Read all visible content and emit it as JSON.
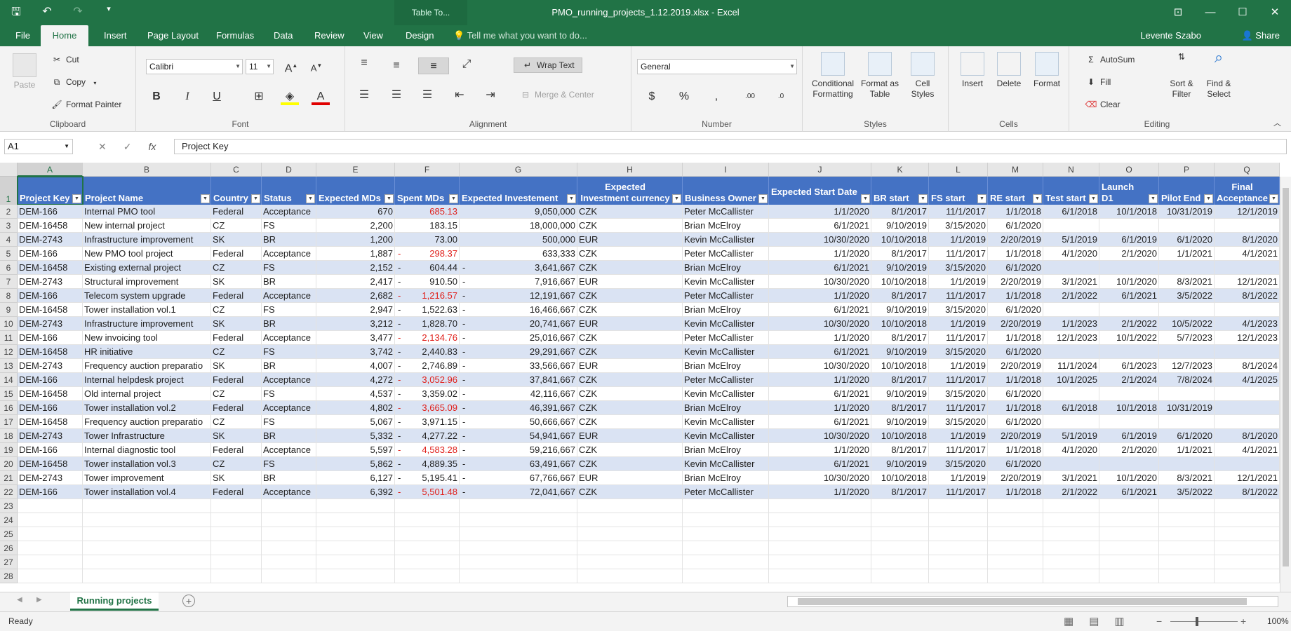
{
  "window": {
    "title": "PMO_running_projects_1.12.2019.xlsx - Excel",
    "context_tab": "Table To..."
  },
  "menu": {
    "tabs": [
      "File",
      "Home",
      "Insert",
      "Page Layout",
      "Formulas",
      "Data",
      "Review",
      "View",
      "Design"
    ],
    "tell_me": "Tell me what you want to do...",
    "user": "Levente Szabo",
    "share": "Share"
  },
  "ribbon": {
    "clipboard": {
      "label": "Clipboard",
      "paste": "Paste",
      "cut": "Cut",
      "copy": "Copy",
      "format_painter": "Format Painter"
    },
    "font": {
      "label": "Font",
      "name": "Calibri",
      "size": "11"
    },
    "alignment": {
      "label": "Alignment",
      "wrap": "Wrap Text",
      "merge": "Merge & Center"
    },
    "number": {
      "label": "Number",
      "format": "General"
    },
    "styles": {
      "label": "Styles",
      "conditional": "Conditional Formatting",
      "format_table": "Format as Table",
      "cell_styles": "Cell Styles"
    },
    "cells": {
      "label": "Cells",
      "insert": "Insert",
      "delete": "Delete",
      "format": "Format"
    },
    "editing": {
      "label": "Editing",
      "autosum": "AutoSum",
      "fill": "Fill",
      "clear": "Clear",
      "sort": "Sort & Filter",
      "find": "Find & Select"
    }
  },
  "formula_bar": {
    "name_box": "A1",
    "formula": "Project Key",
    "fx": "fx"
  },
  "columns": [
    "A",
    "B",
    "C",
    "D",
    "E",
    "F",
    "G",
    "H",
    "I",
    "J",
    "K",
    "L",
    "M",
    "N",
    "O",
    "P",
    "Q"
  ],
  "headers": [
    "Project Key",
    "Project Name",
    "Country",
    "Status",
    "Expected MDs",
    "Spent MDs",
    "Expected Investement",
    "Expected Investment currency",
    "Business Owner",
    "Expected Start Date",
    "BR start",
    "FS start",
    "RE start",
    "Test start",
    "Launch D1",
    "Pilot End",
    "Final Acceptance"
  ],
  "rows": [
    [
      "DEM-166",
      "Internal PMO tool",
      "Federal",
      "Acceptance",
      "670",
      "685.13",
      "",
      "9,050,000",
      "",
      "CZK",
      "Peter McCallister",
      "1/1/2020",
      "8/1/2017",
      "11/1/2017",
      "1/1/2018",
      "6/1/2018",
      "10/1/2018",
      "10/31/2019",
      "12/1/2019"
    ],
    [
      "DEM-16458",
      "New internal project",
      "CZ",
      "FS",
      "2,200",
      "183.15",
      "",
      "18,000,000",
      "",
      "CZK",
      "Brian McElroy",
      "6/1/2021",
      "9/10/2019",
      "3/15/2020",
      "6/1/2020",
      "",
      "",
      "",
      ""
    ],
    [
      "DEM-2743",
      "Infrastructure improvement",
      "SK",
      "BR",
      "1,200",
      "73.00",
      "",
      "500,000",
      "",
      "EUR",
      "Kevin McCallister",
      "10/30/2020",
      "10/10/2018",
      "1/1/2019",
      "2/20/2019",
      "5/1/2019",
      "6/1/2019",
      "6/1/2020",
      "8/1/2020"
    ],
    [
      "DEM-166",
      "New PMO tool project",
      "Federal",
      "Acceptance",
      "1,887",
      "298.37",
      "-",
      "633,333",
      "",
      "CZK",
      "Peter McCallister",
      "1/1/2020",
      "8/1/2017",
      "11/1/2017",
      "1/1/2018",
      "4/1/2020",
      "2/1/2020",
      "1/1/2021",
      "4/1/2021"
    ],
    [
      "DEM-16458",
      "Existing external project",
      "CZ",
      "FS",
      "2,152",
      "604.44",
      "-",
      "3,641,667",
      "-",
      "CZK",
      "Brian McElroy",
      "6/1/2021",
      "9/10/2019",
      "3/15/2020",
      "6/1/2020",
      "",
      "",
      "",
      ""
    ],
    [
      "DEM-2743",
      "Structural improvement",
      "SK",
      "BR",
      "2,417",
      "910.50",
      "-",
      "7,916,667",
      "-",
      "EUR",
      "Kevin McCallister",
      "10/30/2020",
      "10/10/2018",
      "1/1/2019",
      "2/20/2019",
      "3/1/2021",
      "10/1/2020",
      "8/3/2021",
      "12/1/2021"
    ],
    [
      "DEM-166",
      "Telecom system upgrade",
      "Federal",
      "Acceptance",
      "2,682",
      "1,216.57",
      "-",
      "12,191,667",
      "-",
      "CZK",
      "Peter McCallister",
      "1/1/2020",
      "8/1/2017",
      "11/1/2017",
      "1/1/2018",
      "2/1/2022",
      "6/1/2021",
      "3/5/2022",
      "8/1/2022"
    ],
    [
      "DEM-16458",
      "Tower installation vol.1",
      "CZ",
      "FS",
      "2,947",
      "1,522.63",
      "-",
      "16,466,667",
      "-",
      "CZK",
      "Brian McElroy",
      "6/1/2021",
      "9/10/2019",
      "3/15/2020",
      "6/1/2020",
      "",
      "",
      "",
      ""
    ],
    [
      "DEM-2743",
      "Infrastructure improvement",
      "SK",
      "BR",
      "3,212",
      "1,828.70",
      "-",
      "20,741,667",
      "-",
      "EUR",
      "Kevin McCallister",
      "10/30/2020",
      "10/10/2018",
      "1/1/2019",
      "2/20/2019",
      "1/1/2023",
      "2/1/2022",
      "10/5/2022",
      "4/1/2023"
    ],
    [
      "DEM-166",
      "New invoicing tool",
      "Federal",
      "Acceptance",
      "3,477",
      "2,134.76",
      "-",
      "25,016,667",
      "-",
      "CZK",
      "Peter McCallister",
      "1/1/2020",
      "8/1/2017",
      "11/1/2017",
      "1/1/2018",
      "12/1/2023",
      "10/1/2022",
      "5/7/2023",
      "12/1/2023"
    ],
    [
      "DEM-16458",
      "HR initiative",
      "CZ",
      "FS",
      "3,742",
      "2,440.83",
      "-",
      "29,291,667",
      "-",
      "CZK",
      "Kevin McCallister",
      "6/1/2021",
      "9/10/2019",
      "3/15/2020",
      "6/1/2020",
      "",
      "",
      "",
      ""
    ],
    [
      "DEM-2743",
      "Frequency auction preparatio",
      "SK",
      "BR",
      "4,007",
      "2,746.89",
      "-",
      "33,566,667",
      "-",
      "EUR",
      "Brian McElroy",
      "10/30/2020",
      "10/10/2018",
      "1/1/2019",
      "2/20/2019",
      "11/1/2024",
      "6/1/2023",
      "12/7/2023",
      "8/1/2024"
    ],
    [
      "DEM-166",
      "Internal helpdesk project",
      "Federal",
      "Acceptance",
      "4,272",
      "3,052.96",
      "-",
      "37,841,667",
      "-",
      "CZK",
      "Peter McCallister",
      "1/1/2020",
      "8/1/2017",
      "11/1/2017",
      "1/1/2018",
      "10/1/2025",
      "2/1/2024",
      "7/8/2024",
      "4/1/2025"
    ],
    [
      "DEM-16458",
      "Old internal project",
      "CZ",
      "FS",
      "4,537",
      "3,359.02",
      "-",
      "42,116,667",
      "-",
      "CZK",
      "Kevin McCallister",
      "6/1/2021",
      "9/10/2019",
      "3/15/2020",
      "6/1/2020",
      "",
      "",
      "",
      ""
    ],
    [
      "DEM-166",
      "Tower installation vol.2",
      "Federal",
      "Acceptance",
      "4,802",
      "3,665.09",
      "-",
      "46,391,667",
      "-",
      "CZK",
      "Brian McElroy",
      "1/1/2020",
      "8/1/2017",
      "11/1/2017",
      "1/1/2018",
      "6/1/2018",
      "10/1/2018",
      "10/31/2019",
      ""
    ],
    [
      "DEM-16458",
      "Frequency auction preparatio",
      "CZ",
      "FS",
      "5,067",
      "3,971.15",
      "-",
      "50,666,667",
      "-",
      "CZK",
      "Kevin McCallister",
      "6/1/2021",
      "9/10/2019",
      "3/15/2020",
      "6/1/2020",
      "",
      "",
      "",
      ""
    ],
    [
      "DEM-2743",
      "Tower Infrastructure",
      "SK",
      "BR",
      "5,332",
      "4,277.22",
      "-",
      "54,941,667",
      "-",
      "EUR",
      "Kevin McCallister",
      "10/30/2020",
      "10/10/2018",
      "1/1/2019",
      "2/20/2019",
      "5/1/2019",
      "6/1/2019",
      "6/1/2020",
      "8/1/2020"
    ],
    [
      "DEM-166",
      "Internal diagnostic tool",
      "Federal",
      "Acceptance",
      "5,597",
      "4,583.28",
      "-",
      "59,216,667",
      "-",
      "CZK",
      "Brian McElroy",
      "1/1/2020",
      "8/1/2017",
      "11/1/2017",
      "1/1/2018",
      "4/1/2020",
      "2/1/2020",
      "1/1/2021",
      "4/1/2021"
    ],
    [
      "DEM-16458",
      "Tower installation vol.3",
      "CZ",
      "FS",
      "5,862",
      "4,889.35",
      "-",
      "63,491,667",
      "-",
      "CZK",
      "Kevin McCallister",
      "6/1/2021",
      "9/10/2019",
      "3/15/2020",
      "6/1/2020",
      "",
      "",
      "",
      ""
    ],
    [
      "DEM-2743",
      "Tower improvement",
      "SK",
      "BR",
      "6,127",
      "5,195.41",
      "-",
      "67,766,667",
      "-",
      "EUR",
      "Brian McElroy",
      "10/30/2020",
      "10/10/2018",
      "1/1/2019",
      "2/20/2019",
      "3/1/2021",
      "10/1/2020",
      "8/3/2021",
      "12/1/2021"
    ],
    [
      "DEM-166",
      "Tower installation vol.4",
      "Federal",
      "Acceptance",
      "6,392",
      "5,501.48",
      "-",
      "72,041,667",
      "-",
      "CZK",
      "Peter McCallister",
      "1/1/2020",
      "8/1/2017",
      "11/1/2017",
      "1/1/2018",
      "2/1/2022",
      "6/1/2021",
      "3/5/2022",
      "8/1/2022"
    ]
  ],
  "neg_rows_spent": [
    0,
    3,
    6,
    9,
    12,
    14,
    17,
    20
  ],
  "empty_rows": [
    "23",
    "24",
    "25",
    "26",
    "27",
    "28"
  ],
  "sheet": {
    "tab": "Running projects"
  },
  "status": {
    "ready": "Ready",
    "zoom": "100%"
  },
  "colors": {
    "excel_green": "#217346",
    "table_header": "#4472c4",
    "band": "#dae3f3",
    "negative": "#e0201b"
  }
}
